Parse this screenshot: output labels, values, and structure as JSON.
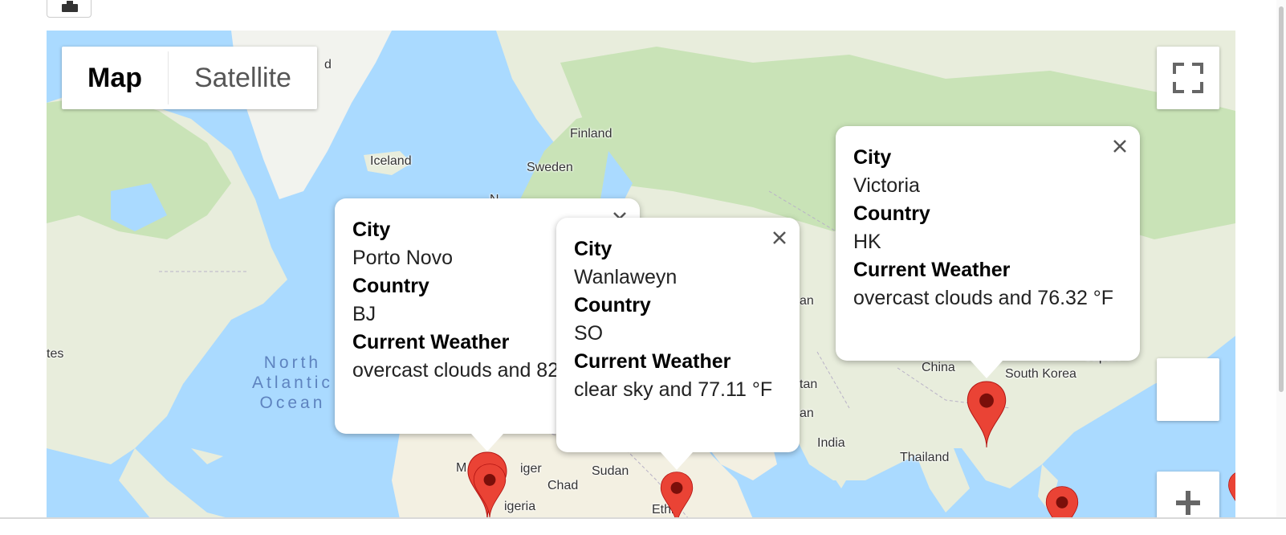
{
  "map": {
    "type_control": {
      "map_label": "Map",
      "satellite_label": "Satellite",
      "selected": "Map"
    },
    "place_labels": {
      "finland": "Finland",
      "iceland": "Iceland",
      "sweden": "Sweden",
      "north_atlantic_ocean": "North\nAtlantic\nOcean",
      "china": "China",
      "south_korea": "South Korea",
      "india": "India",
      "thailand": "Thailand",
      "sudan": "Sudan",
      "chad": "Chad",
      "niger": "iger",
      "nigeria": "igeria",
      "mali": "M",
      "japan": "Japan",
      "pakistan": "tan",
      "iran": "an",
      "afghanistan": "an",
      "united_states": "tes",
      "greenland": "d",
      "ethiopia": "Ethio",
      "norway": "N"
    },
    "info_windows": [
      {
        "city_label": "City",
        "city": "Porto Novo",
        "country_label": "Country",
        "country": "BJ",
        "weather_label": "Current Weather",
        "weather": "overcast clouds and 82"
      },
      {
        "city_label": "City",
        "city": "Wanlaweyn",
        "country_label": "Country",
        "country": "SO",
        "weather_label": "Current Weather",
        "weather": "clear sky and 77.11 °F"
      },
      {
        "city_label": "City",
        "city": "Victoria",
        "country_label": "Country",
        "country": "HK",
        "weather_label": "Current Weather",
        "weather": "overcast clouds and 76.32 °F"
      }
    ],
    "colors": {
      "water": "#aadaff",
      "land": "#e8eddc",
      "forest": "#c9e3b7",
      "marker": "#ea4335"
    },
    "icons": [
      "fullscreen-icon",
      "zoom-in-icon",
      "close-icon",
      "map-marker-icon"
    ]
  }
}
